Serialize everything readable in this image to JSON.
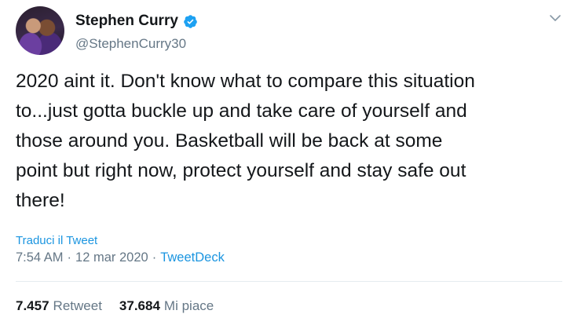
{
  "author": {
    "display_name": "Stephen Curry",
    "handle": "@StephenCurry30",
    "verified": true,
    "avatar": "profile-photo"
  },
  "tweet": {
    "lines": [
      "2020 aint it. Don't know what to compare this situation",
      "to...just gotta buckle up and take care of yourself and",
      "those around you. Basketball will be back at some",
      "point but right now, protect yourself and stay safe out",
      "there!"
    ],
    "translate_label": "Traduci il Tweet",
    "time": "7:54 AM",
    "date": "12 mar 2020",
    "source": "TweetDeck",
    "separator": "·"
  },
  "stats": {
    "retweets_count": "7.457",
    "retweets_label": "Retweet",
    "likes_count": "37.684",
    "likes_label": "Mi piace"
  },
  "icons": {
    "verified": "verified-badge-icon",
    "menu": "chevron-down-icon"
  },
  "colors": {
    "link": "#1b95e0",
    "verified": "#1da1f2",
    "secondary_text": "#657786",
    "primary_text": "#14171a",
    "divider": "#e6ecf0"
  }
}
